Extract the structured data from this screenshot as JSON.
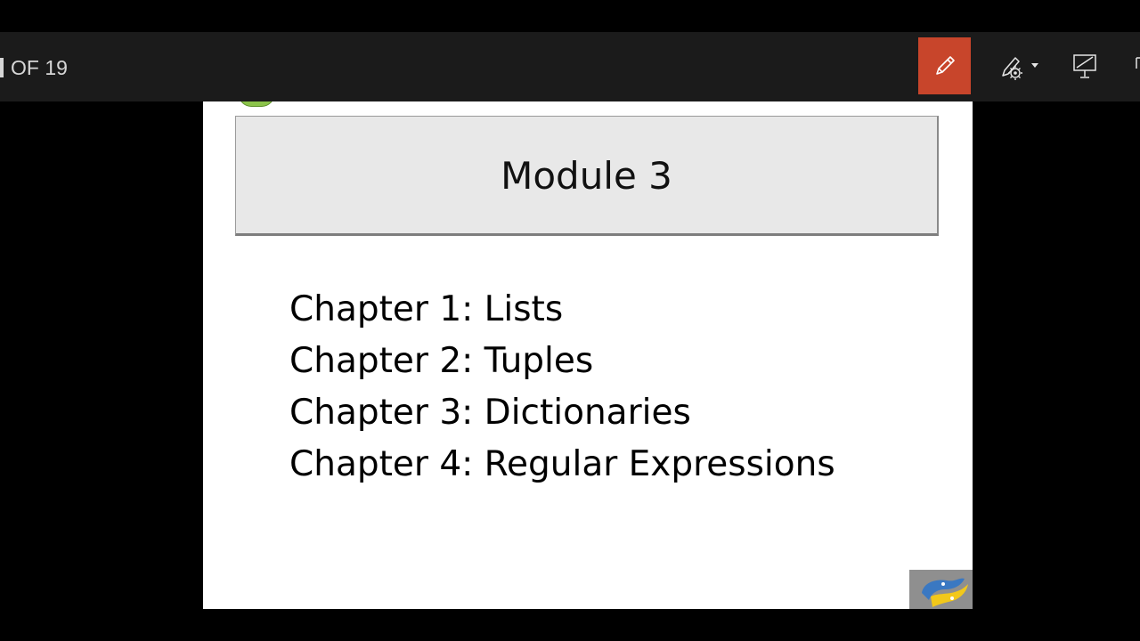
{
  "toolbar": {
    "slide_counter": "OF 19",
    "pen_icon": "pen-icon",
    "laser_icon": "laser-pointer-icon",
    "screen_icon": "screen-icon",
    "more_icon": "more-icon",
    "pen_color": "#c8452b"
  },
  "slide": {
    "title": "Module 3",
    "chapters": [
      "Chapter 1: Lists",
      "Chapter 2: Tuples",
      "Chapter 3: Dictionaries",
      "Chapter 4: Regular Expressions"
    ],
    "logo_icon": "python-logo"
  }
}
